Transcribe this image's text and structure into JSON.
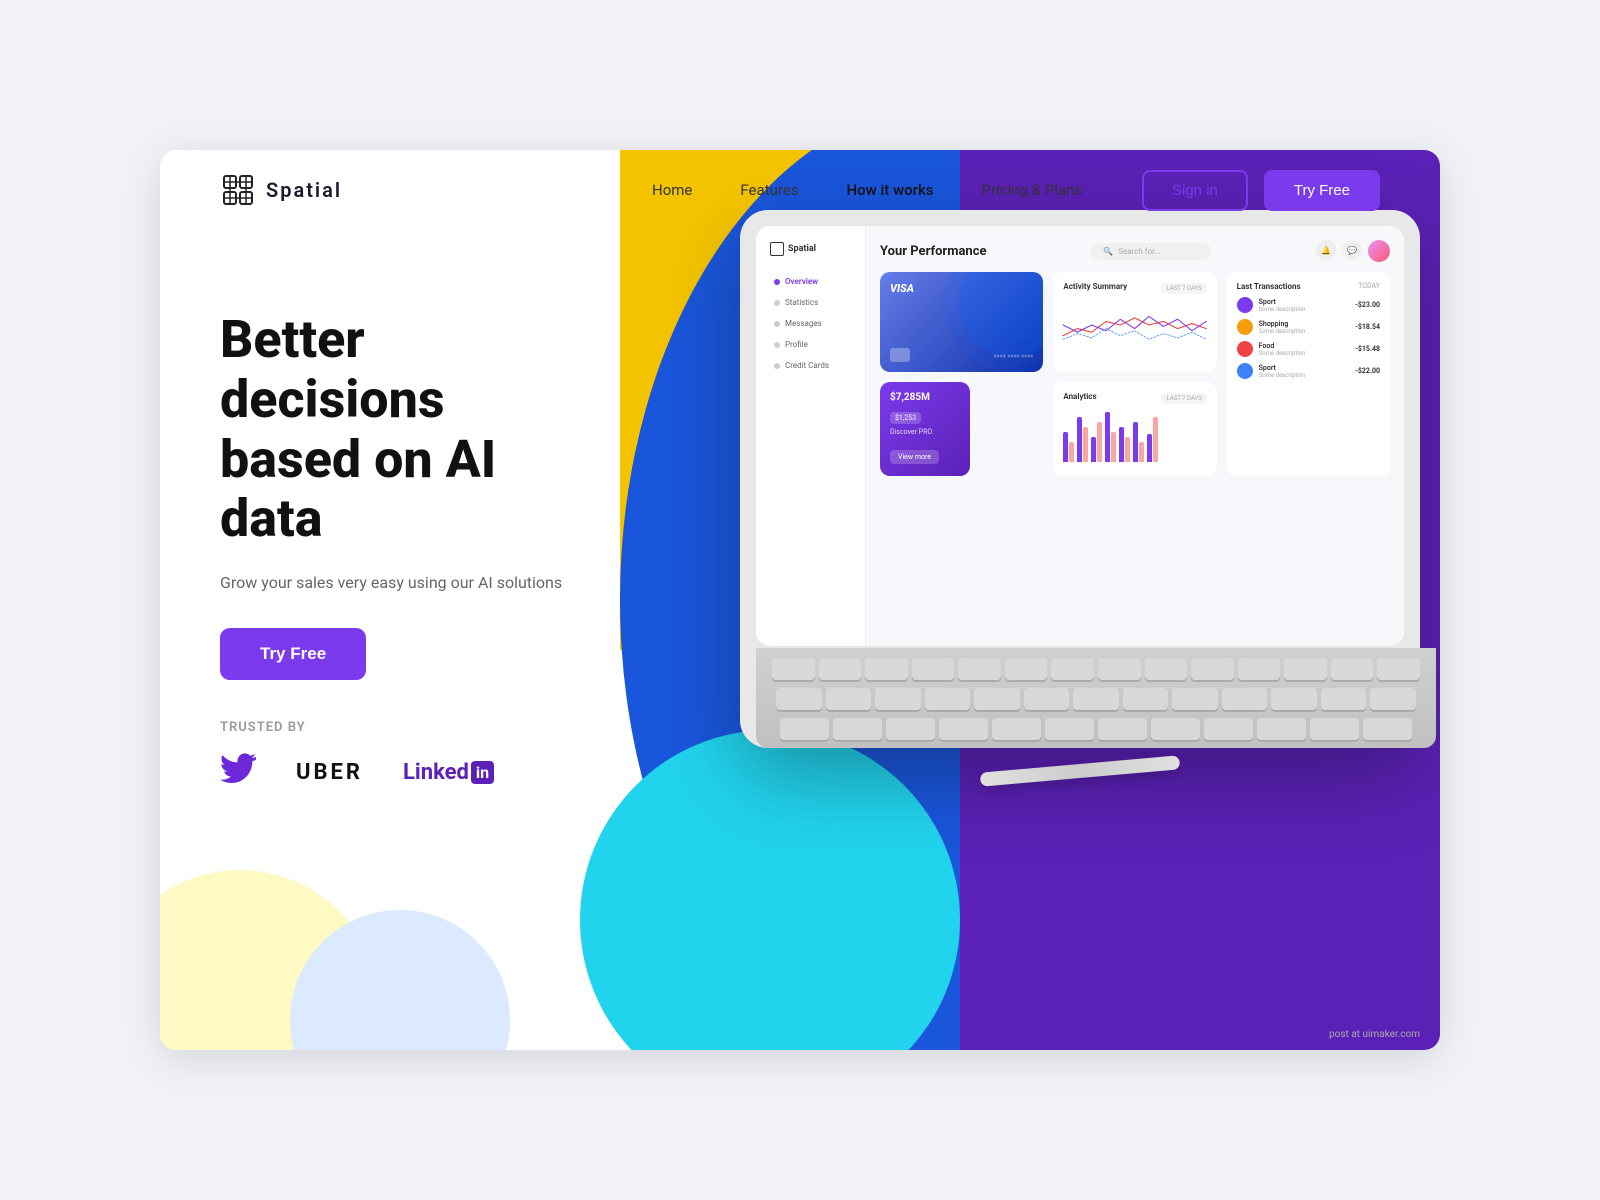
{
  "meta": {
    "title": "Spatial - Better decisions based on AI data",
    "attribution": "post at uimaker.com"
  },
  "nav": {
    "logo": "Spatial",
    "links": [
      {
        "id": "home",
        "label": "Home"
      },
      {
        "id": "features",
        "label": "Features"
      },
      {
        "id": "how-it-works",
        "label": "How it works"
      },
      {
        "id": "pricing",
        "label": "Pricing & Plans"
      }
    ],
    "sign_in": "Sign in",
    "try_free": "Try Free"
  },
  "hero": {
    "title_line1": "Better decisions",
    "title_line2": "based on AI data",
    "subtitle": "Grow your sales very easy using our AI solutions",
    "cta": "Try Free"
  },
  "trusted": {
    "label": "TRUSTED BY",
    "companies": [
      "Twitter",
      "UBER",
      "LinkedIn"
    ]
  },
  "dashboard": {
    "title": "Your Performance",
    "search_placeholder": "Search for...",
    "nav_items": [
      "Overview",
      "Statistics",
      "Messages",
      "Profile",
      "Credit Cards"
    ],
    "activity_title": "Activity Summary",
    "activity_period": "LAST 7 DAYS",
    "analytics_title": "Analytics",
    "analytics_period": "LAST 7 DAYS",
    "discover_value": "$7,285M",
    "discover_sub": "$1,253",
    "discover_label": "Discover PRO",
    "discover_btn": "View more",
    "transactions_title": "Last Transactions",
    "transactions_period": "TODAY",
    "transactions": [
      {
        "name": "Sport",
        "desc": "Some description",
        "amount": "-$23.00",
        "color": "#7C3AED"
      },
      {
        "name": "Shopping",
        "desc": "Some description",
        "amount": "-$18.54",
        "color": "#F59E0B"
      },
      {
        "name": "Food",
        "desc": "Some description",
        "amount": "-$15.48",
        "color": "#EF4444"
      },
      {
        "name": "Sport",
        "desc": "Some description",
        "amount": "-$22.00",
        "color": "#3B82F6"
      }
    ]
  },
  "colors": {
    "purple": "#7C3AED",
    "yellow": "#F5C400",
    "blue": "#1A56DB",
    "cyan": "#22D3EE",
    "white": "#FFFFFF"
  }
}
